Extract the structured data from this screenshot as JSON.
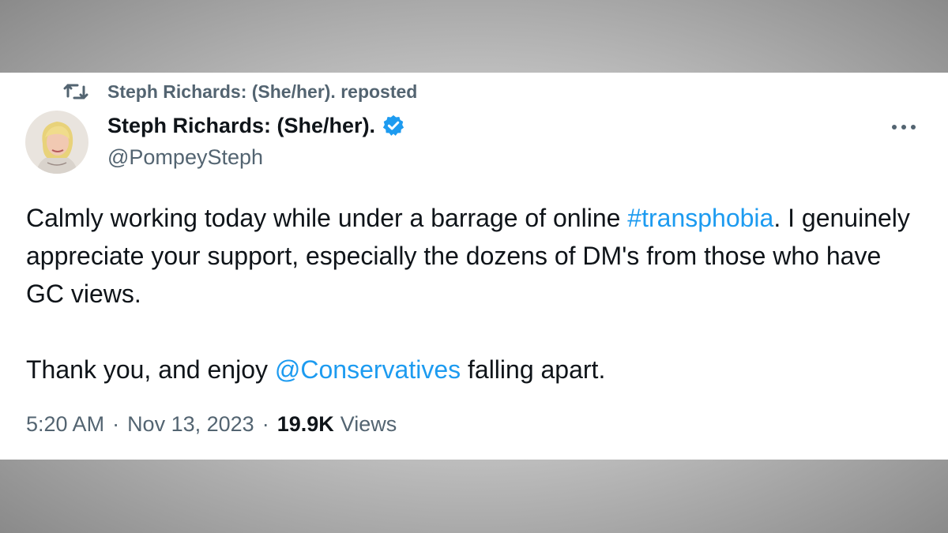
{
  "repost": {
    "icon": "repost-icon",
    "text": "Steph Richards: (She/her). reposted"
  },
  "author": {
    "display_name": "Steph Richards: (She/her).",
    "handle": "@PompeySteph",
    "verified_icon": "verified-badge-icon",
    "avatar": "avatar"
  },
  "more_icon": "more-options-icon",
  "tweet": {
    "p1_a": "Calmly working today while under a barrage of online ",
    "p1_link": "#transphobia",
    "p1_b": ". I genuinely appreciate your support, especially the dozens of DM's from those who have GC views.",
    "p2_a": "Thank you, and enjoy ",
    "p2_link": "@Conservatives",
    "p2_b": " falling apart."
  },
  "meta": {
    "time": "5:20 AM",
    "separator": "·",
    "date": "Nov 13, 2023",
    "views_count": "19.9K",
    "views_label": "Views"
  },
  "colors": {
    "link": "#1d9bf0",
    "secondary_text": "#536471",
    "primary_text": "#0f1419"
  }
}
